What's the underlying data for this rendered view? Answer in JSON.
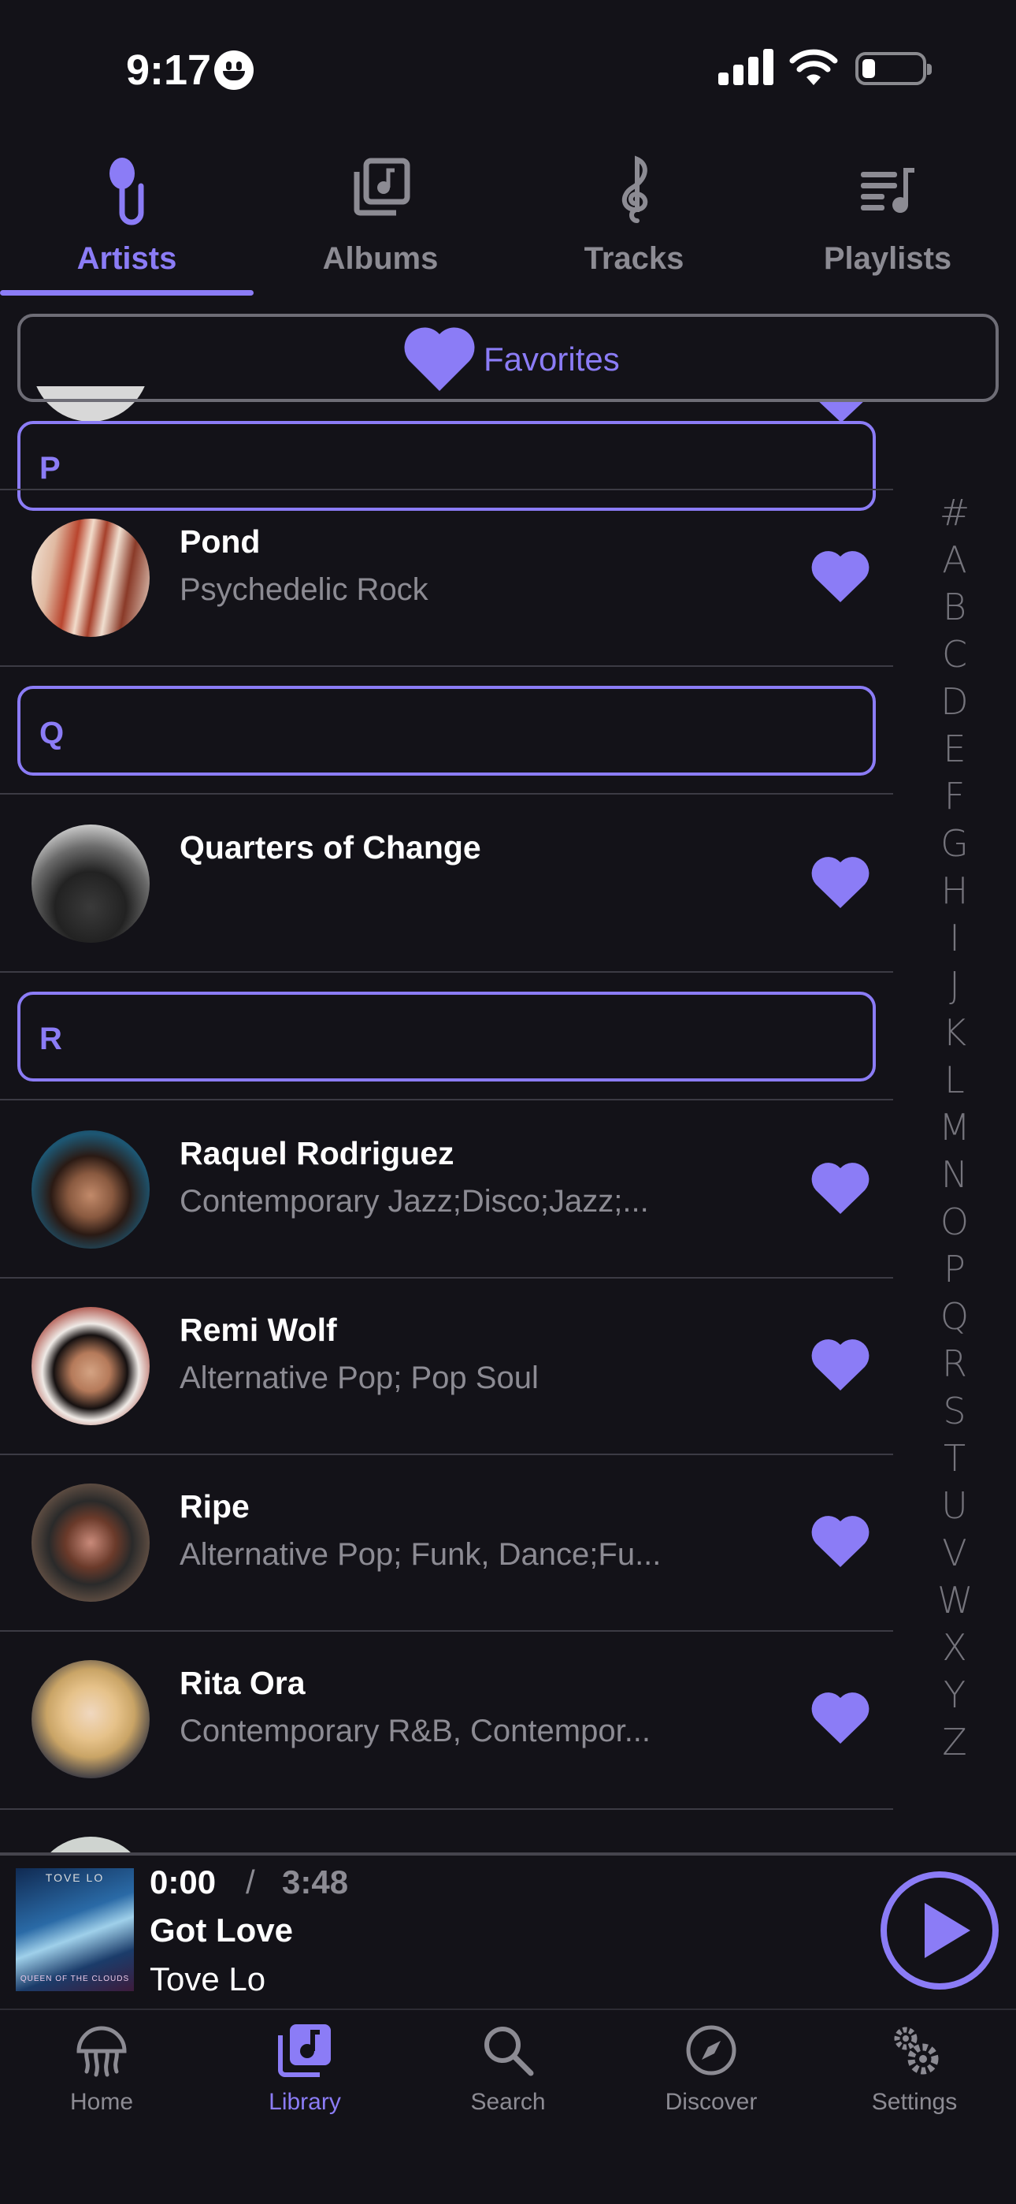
{
  "status_bar": {
    "time": "9:17"
  },
  "top_tabs": [
    {
      "label": "Artists",
      "icon": "microphone-icon",
      "active": true
    },
    {
      "label": "Albums",
      "icon": "album-icon",
      "active": false
    },
    {
      "label": "Tracks",
      "icon": "treble-clef-icon",
      "active": false
    },
    {
      "label": "Playlists",
      "icon": "playlist-icon",
      "active": false
    }
  ],
  "favorites": {
    "label": "Favorites"
  },
  "sections": [
    {
      "letter": "P",
      "artists": [
        {
          "name": "Pond",
          "genre": "Psychedelic Rock"
        }
      ]
    },
    {
      "letter": "Q",
      "artists": [
        {
          "name": "Quarters of Change",
          "genre": ""
        }
      ]
    },
    {
      "letter": "R",
      "artists": [
        {
          "name": "Raquel Rodriguez",
          "genre": "Contemporary Jazz;Disco;Jazz;..."
        },
        {
          "name": "Remi Wolf",
          "genre": "Alternative Pop; Pop Soul"
        },
        {
          "name": "Ripe",
          "genre": "Alternative Pop; Funk, Dance;Fu..."
        },
        {
          "name": "Rita Ora",
          "genre": "Contemporary R&B, Contempor..."
        }
      ]
    }
  ],
  "alphabet_index": [
    "#",
    "A",
    "B",
    "C",
    "D",
    "E",
    "F",
    "G",
    "H",
    "I",
    "J",
    "K",
    "L",
    "M",
    "N",
    "O",
    "P",
    "Q",
    "R",
    "S",
    "T",
    "U",
    "V",
    "W",
    "X",
    "Y",
    "Z"
  ],
  "now_playing": {
    "current_time": "0:00",
    "separator": "/",
    "duration": "3:48",
    "title": "Got Love",
    "artist": "Tove Lo",
    "cover_text_top": "TOVE LO",
    "cover_text_bottom": "QUEEN OF THE CLOUDS"
  },
  "bottom_nav": [
    {
      "label": "Home",
      "icon": "jellyfish-icon",
      "active": false
    },
    {
      "label": "Library",
      "icon": "music-library-icon",
      "active": true
    },
    {
      "label": "Search",
      "icon": "search-icon",
      "active": false
    },
    {
      "label": "Discover",
      "icon": "compass-icon",
      "active": false
    },
    {
      "label": "Settings",
      "icon": "gear-icon",
      "active": false
    }
  ],
  "colors": {
    "accent": "#8b7cf6",
    "background": "#131218",
    "muted": "#8c8b93"
  }
}
